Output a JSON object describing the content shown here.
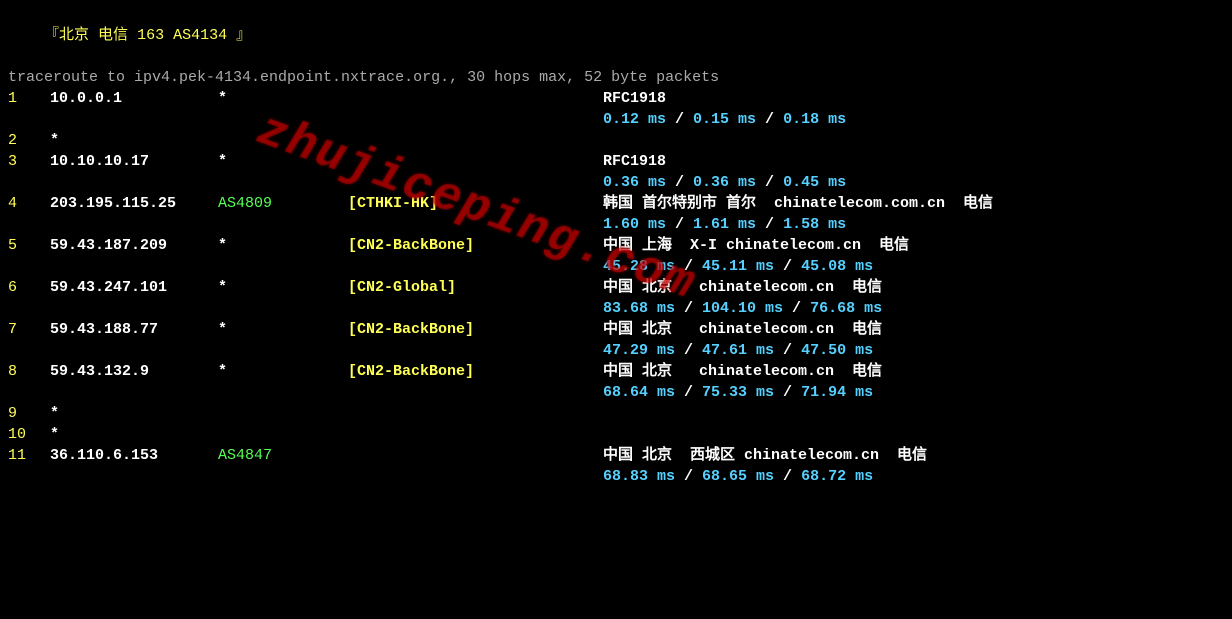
{
  "header": {
    "open_bracket": "『",
    "location": "北京 电信",
    "asn_label": "163 AS4134",
    "close_bracket": "』",
    "command": "traceroute to ipv4.pek-4134.endpoint.nxtrace.org., 30 hops max, 52 byte packets"
  },
  "watermark": "zhujiceping.com",
  "hops": [
    {
      "n": "1",
      "ip": "10.0.0.1",
      "asn": "*",
      "tag": "",
      "info": "RFC1918",
      "times": [
        "0.12 ms",
        "0.15 ms",
        "0.18 ms"
      ]
    },
    {
      "n": "2",
      "ip": "*",
      "asn": "",
      "tag": "",
      "info": "",
      "times": null
    },
    {
      "n": "3",
      "ip": "10.10.10.17",
      "asn": "*",
      "tag": "",
      "info": "RFC1918",
      "times": [
        "0.36 ms",
        "0.36 ms",
        "0.45 ms"
      ]
    },
    {
      "n": "4",
      "ip": "203.195.115.25",
      "asn": "AS4809",
      "tag": "[CTHKI-HK]",
      "info": "韩国 首尔特别市 首尔  chinatelecom.com.cn  电信",
      "times": [
        "1.60 ms",
        "1.61 ms",
        "1.58 ms"
      ]
    },
    {
      "n": "5",
      "ip": "59.43.187.209",
      "asn": "*",
      "tag": "[CN2-BackBone]",
      "info": "中国 上海  X-I chinatelecom.cn  电信",
      "times": [
        "45.28 ms",
        "45.11 ms",
        "45.08 ms"
      ]
    },
    {
      "n": "6",
      "ip": "59.43.247.101",
      "asn": "*",
      "tag": "[CN2-Global]",
      "info": "中国 北京   chinatelecom.cn  电信",
      "times": [
        "83.68 ms",
        "104.10 ms",
        "76.68 ms"
      ]
    },
    {
      "n": "7",
      "ip": "59.43.188.77",
      "asn": "*",
      "tag": "[CN2-BackBone]",
      "info": "中国 北京   chinatelecom.cn  电信",
      "times": [
        "47.29 ms",
        "47.61 ms",
        "47.50 ms"
      ]
    },
    {
      "n": "8",
      "ip": "59.43.132.9",
      "asn": "*",
      "tag": "[CN2-BackBone]",
      "info": "中国 北京   chinatelecom.cn  电信",
      "times": [
        "68.64 ms",
        "75.33 ms",
        "71.94 ms"
      ]
    },
    {
      "n": "9",
      "ip": "*",
      "asn": "",
      "tag": "",
      "info": "",
      "times": null
    },
    {
      "n": "10",
      "ip": "*",
      "asn": "",
      "tag": "",
      "info": "",
      "times": null
    },
    {
      "n": "11",
      "ip": "36.110.6.153",
      "asn": "AS4847",
      "tag": "",
      "info": "中国 北京  西城区 chinatelecom.cn  电信",
      "times": [
        "68.83 ms",
        "68.65 ms",
        "68.72 ms"
      ]
    }
  ]
}
